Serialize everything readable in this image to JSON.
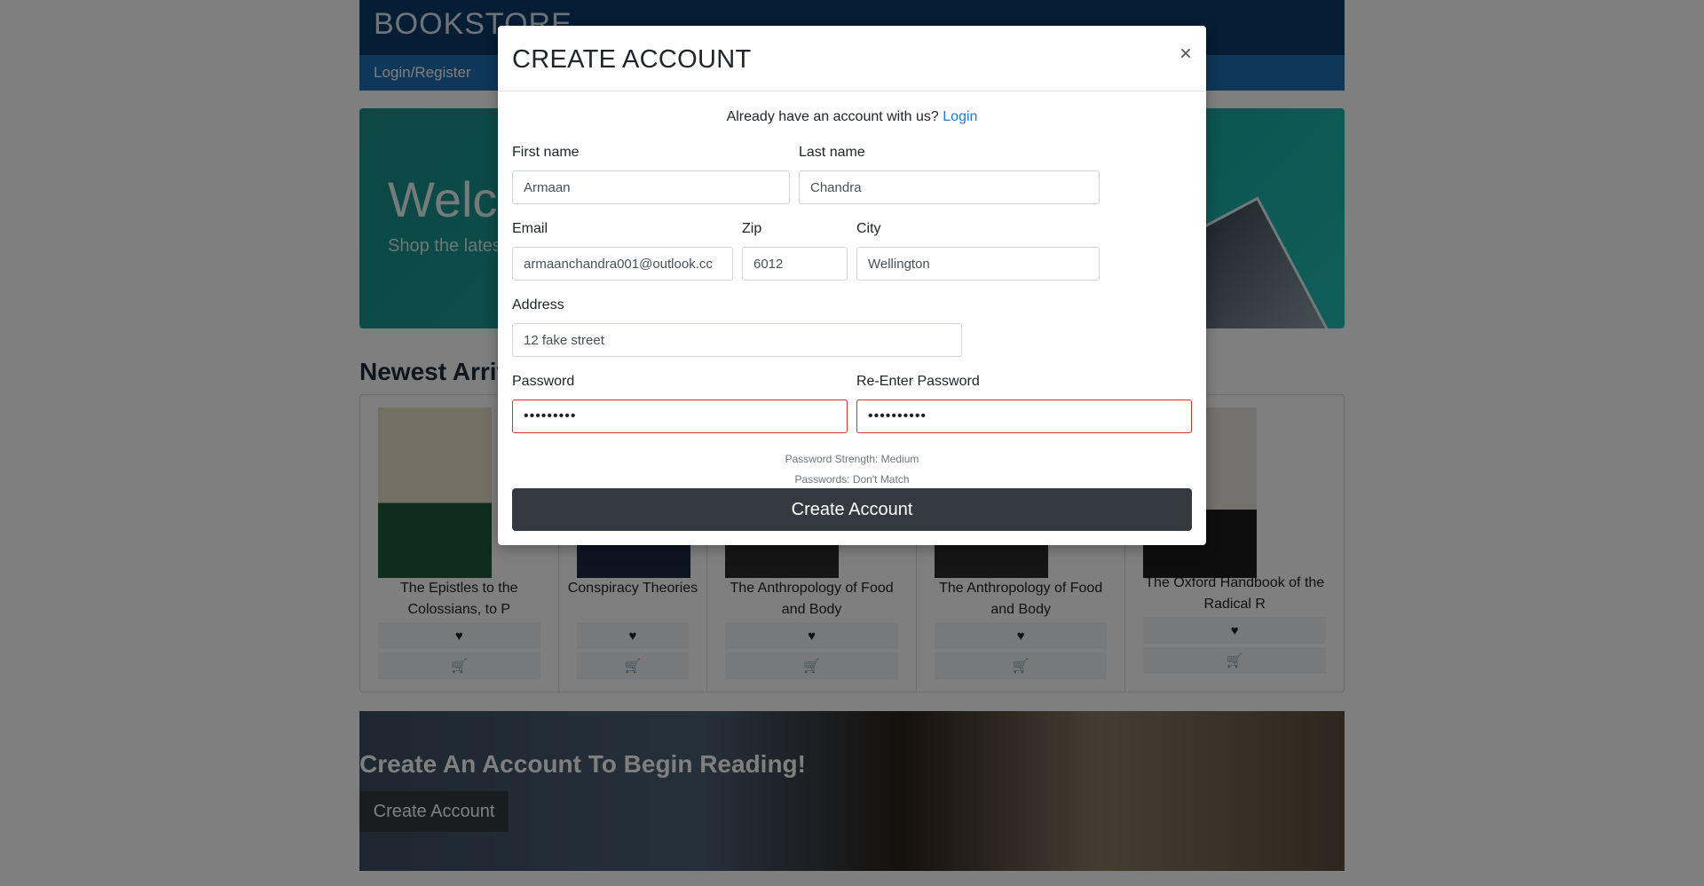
{
  "header": {
    "brand": "BOOKSTORE",
    "nav_login": "Login/Register"
  },
  "hero": {
    "title": "Welcome",
    "subtitle": "Shop the latest"
  },
  "newest": {
    "title": "Newest Arrivals",
    "items": [
      {
        "title": "The Epistles to the Colossians, to P"
      },
      {
        "title": "Conspiracy Theories"
      },
      {
        "title": "The Anthropology of Food and Body"
      },
      {
        "title": "The Anthropology of Food and Body"
      },
      {
        "title": "The Oxford Handbook of the Radical R"
      }
    ],
    "favorite_icon": "heart-icon",
    "cart_icon": "cart-icon"
  },
  "cta": {
    "title": "Create An Account To Begin Reading!",
    "button": "Create Account"
  },
  "modal": {
    "title": "CREATE ACCOUNT",
    "close": "×",
    "already_text": "Already have an account with us?",
    "login_link": "Login",
    "first_name": {
      "label": "First name",
      "value": "Armaan"
    },
    "last_name": {
      "label": "Last name",
      "value": "Chandra"
    },
    "email": {
      "label": "Email",
      "value": "armaanchandra001@outlook.cc"
    },
    "zip": {
      "label": "Zip",
      "value": "6012"
    },
    "city": {
      "label": "City",
      "value": "Wellington"
    },
    "address": {
      "label": "Address",
      "value": "12 fake street"
    },
    "password": {
      "label": "Password",
      "value": "•••••••••"
    },
    "re_password": {
      "label": "Re-Enter Password",
      "value": "••••••••••"
    },
    "strength": "Password Strength: Medium",
    "match": "Passwords: Don't Match",
    "submit": "Create Account"
  },
  "colors": {
    "header": "#0b3a6a",
    "nav": "#1f6fb2",
    "hero": "#15a59d",
    "button_dark": "#343a40",
    "link": "#1a7ae0",
    "error": "#e03131"
  }
}
